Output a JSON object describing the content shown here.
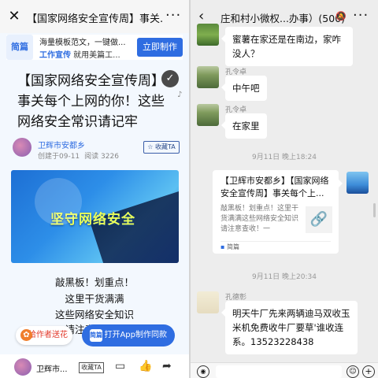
{
  "left": {
    "title": "【国家网络安全宣传周】事关...",
    "ad": {
      "logo": "简篇",
      "line1": "海量模板范文，一键做...",
      "line2_highlight": "工作宣传",
      "line2_rest": " 就用美篇工...",
      "button": "立即制作"
    },
    "article": {
      "title": "【国家网络安全宣传周】事关每个上网的你！这些网络安全常识请记牢",
      "author": "卫辉市安都乡",
      "created": "创建于09-11",
      "reads": "阅读 3226",
      "fav": "☆ 收藏TA",
      "cover_text": "坚守网络安全",
      "lines": [
        "敲黑板！划重点！",
        "这里干货满满",
        "这些网络安全知识",
        "请注意查收！"
      ]
    },
    "float_gift": "给作者送花",
    "float_app": "打开App制作同款",
    "app_icon": "简篇",
    "bottom": {
      "name": "卫辉市...",
      "fav": "收藏TA"
    }
  },
  "right": {
    "title": "庄和村小微权...办事）(500)",
    "messages": [
      {
        "sender": "",
        "text": "蜜薯在家还是在南边，家咋没人？"
      },
      {
        "sender": "孔令卓",
        "text": "中午吧"
      },
      {
        "sender": "孔令卓",
        "text": "在家里"
      }
    ],
    "time1": "9月11日 晚上18:24",
    "card": {
      "title": "【卫辉市安都乡】【国家网络安全宣传周】事关每个上...",
      "desc": "敲黑板！划重点！这里干货满满这些网络安全知识请注意查收！一",
      "source": "简篇"
    },
    "time2": "9月11日 晚上20:34",
    "last": {
      "sender": "孔德彰",
      "text": "明天牛厂先来两辆迪马双收玉米机免费收牛厂要草'谁收连系。13523228438"
    }
  },
  "colors": {
    "accent": "#2f6de1",
    "chat_bg": "#ededed"
  }
}
